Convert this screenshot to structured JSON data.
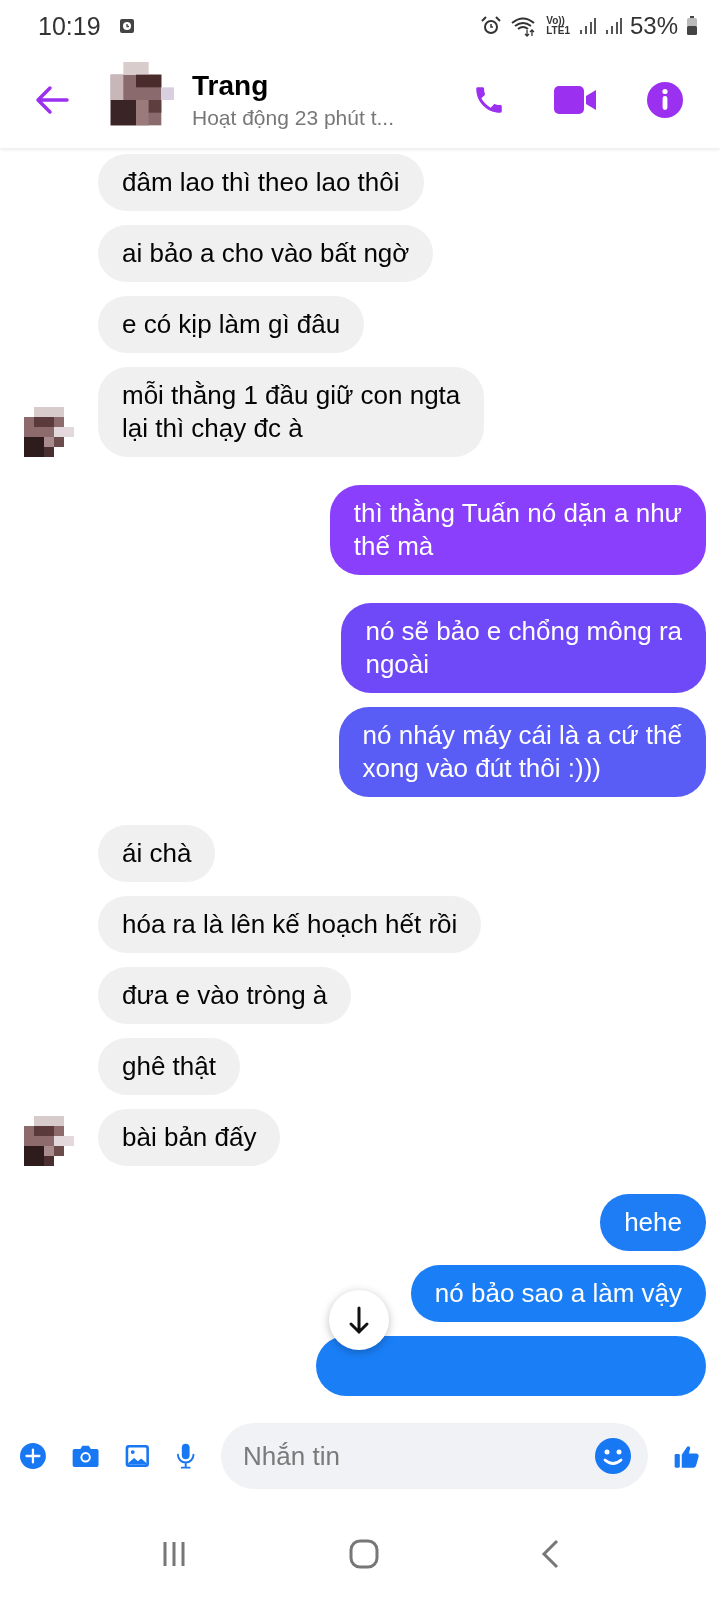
{
  "status_bar": {
    "time": "10:19",
    "network": "Vo))\nLTE1",
    "battery": "53%"
  },
  "header": {
    "name": "Trang",
    "activity": "Hoạt động 23 phút t..."
  },
  "groups": [
    {
      "outgoing": false,
      "messages": [
        {
          "text": "đâm lao thì theo lao thôi"
        },
        {
          "text": "ai bảo a cho vào bất ngờ"
        },
        {
          "text": "e có kịp làm gì đâu"
        },
        {
          "text": "mỗi thằng 1 đầu giữ con ngta\nlại thì chạy đc à"
        }
      ]
    },
    {
      "outgoing": true,
      "messages": [
        {
          "text": "thì thằng Tuấn nó dặn a như\nthế mà",
          "color": "#8a3ffc"
        }
      ]
    },
    {
      "outgoing": true,
      "messages": [
        {
          "text": "nó sẽ bảo e chổng mông ra\nngoài",
          "color": "#6f49f7"
        },
        {
          "text": "nó nháy máy cái là a cứ thế\nxong vào đút thôi :)))",
          "color": "#5a5cf6"
        }
      ]
    },
    {
      "outgoing": false,
      "messages": [
        {
          "text": "ái chà"
        },
        {
          "text": "hóa ra là lên kế hoạch hết rồi"
        },
        {
          "text": "đưa e vào tròng à"
        },
        {
          "text": "ghê thật"
        },
        {
          "text": "bài bản đấy"
        }
      ]
    },
    {
      "outgoing": true,
      "messages": [
        {
          "text": "hehe",
          "color": "#1e7cf5"
        },
        {
          "text": "nó bảo sao a làm vậy",
          "color": "#1a7ef6"
        },
        {
          "kind": "cut",
          "color": "#1a7ef6"
        }
      ]
    }
  ],
  "composer": {
    "placeholder": "Nhắn tin"
  }
}
